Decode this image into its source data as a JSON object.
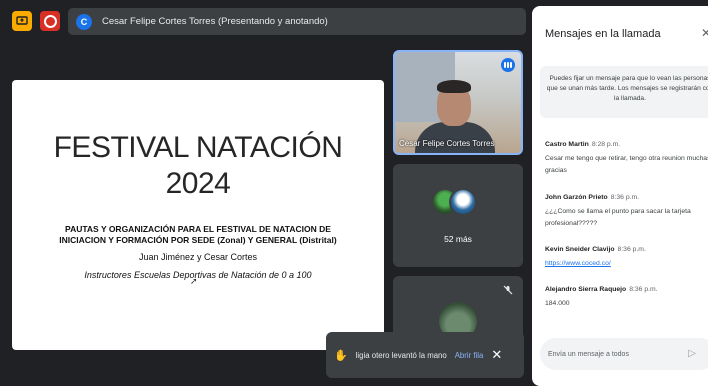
{
  "topbar": {
    "presenting_avatar": "C",
    "presenting_text": "Cesar Felipe Cortes Torres (Presentando y anotando)"
  },
  "slide": {
    "title_line1": "FESTIVAL NATACIÓN",
    "title_line2": "2024",
    "subtitle_line1": "PAUTAS Y ORGANIZACIÓN PARA EL FESTIVAL DE NATACION DE",
    "subtitle_line2": "INICIACION Y FORMACIÓN POR SEDE (Zonal) Y GENERAL (Distrital)",
    "names": "Juan Jiménez y Cesar Cortes",
    "instructors": "Instructores Escuelas Deportivas de Natación de 0 a 100"
  },
  "tiles": {
    "speaker_name": "Cesar Felipe Cortes Torres",
    "more_label": "52 más"
  },
  "toast": {
    "text": "ligia otero levantó la mano",
    "action": "Abrir fila",
    "close": "✕"
  },
  "chat": {
    "title": "Mensajes en la llamada",
    "close": "✕",
    "pin_note": "Puedes fijar un mensaje para que lo vean las personas que se unan más tarde. Los mensajes se registrarán con la llamada.",
    "messages": [
      {
        "sender": "Castro Martin",
        "time": "8:28 p.m.",
        "text": "Cesar me tengo que retirar, tengo otra reunion muchas gracias"
      },
      {
        "sender": "John Garzón Prieto",
        "time": "8:36 p.m.",
        "text": "¿¿¿Como se llama el punto para sacar la tarjeta profesional?????"
      },
      {
        "sender": "Kevin Sneider Clavijo",
        "time": "8:36 p.m.",
        "text": "https://www.coced.co/"
      },
      {
        "sender": "Alejandro Sierra Raquejo",
        "time": "8:36 p.m.",
        "text": "184.000"
      }
    ],
    "input_placeholder": "Envía un mensaje a todos"
  },
  "colors": {
    "background": "#202124",
    "accent": "#1a73e8",
    "present_button": "#f9ab00",
    "record_button": "#d93025"
  },
  "icons": [
    "present-icon",
    "record-icon",
    "speaking-icon",
    "mic-off-icon",
    "hand-raised-icon",
    "close-icon",
    "send-icon"
  ]
}
